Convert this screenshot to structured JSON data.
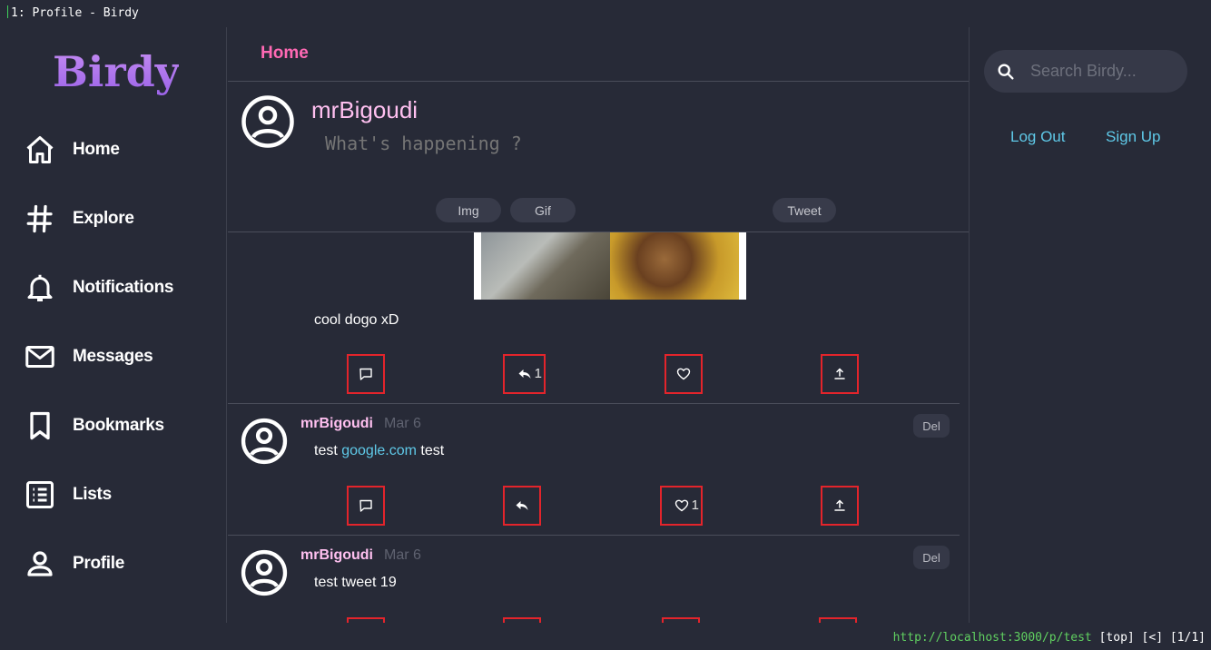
{
  "window": {
    "title": "1: Profile - Birdy"
  },
  "statusbar": {
    "url": "http://localhost:3000/p/test",
    "info": "[top] [<] [1/1]"
  },
  "brand": {
    "name": "Birdy"
  },
  "nav": {
    "items": [
      {
        "label": "Home",
        "icon": "home-icon"
      },
      {
        "label": "Explore",
        "icon": "hash-icon"
      },
      {
        "label": "Notifications",
        "icon": "bell-icon"
      },
      {
        "label": "Messages",
        "icon": "mail-icon"
      },
      {
        "label": "Bookmarks",
        "icon": "bookmark-icon"
      },
      {
        "label": "Lists",
        "icon": "list-icon"
      },
      {
        "label": "Profile",
        "icon": "person-icon"
      }
    ]
  },
  "header": {
    "title": "Home"
  },
  "composer": {
    "username": "mrBigoudi",
    "placeholder": "What's happening ?",
    "img_label": "Img",
    "gif_label": "Gif",
    "tweet_label": "Tweet"
  },
  "posts": [
    {
      "text": "cool dogo xD",
      "retweets": "1"
    },
    {
      "author": "mrBigoudi",
      "date": "Mar 6",
      "text_before": "test ",
      "link": "google.com",
      "text_after": " test",
      "likes": "1",
      "del_label": "Del"
    },
    {
      "author": "mrBigoudi",
      "date": "Mar 6",
      "text": "test tweet 19",
      "del_label": "Del"
    }
  ],
  "search": {
    "placeholder": "Search Birdy..."
  },
  "auth": {
    "logout_label": "Log Out",
    "signup_label": "Sign Up"
  },
  "colors": {
    "accent_pink": "#ff69b4",
    "username_pink": "#ffc0f0",
    "link_cyan": "#5fc9e8",
    "action_border_red": "#e3242b",
    "background": "#272a37"
  }
}
